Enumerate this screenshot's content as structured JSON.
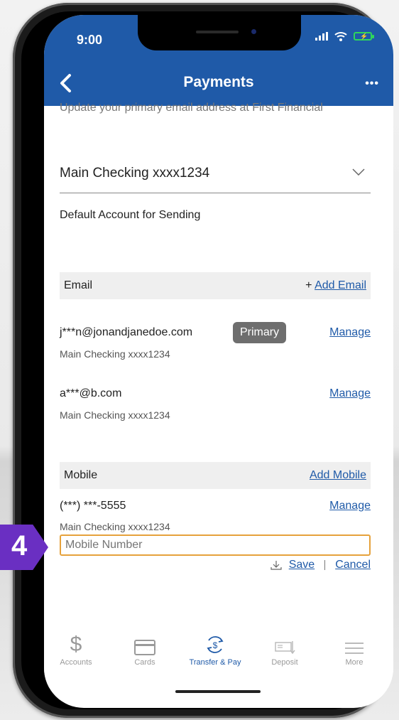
{
  "status": {
    "time": "9:00"
  },
  "header": {
    "title": "Payments"
  },
  "intro_cut_text": "Update your primary email address at First Financial",
  "account_select": {
    "value": "Main Checking xxxx1234"
  },
  "default_account_text": "Default Account for Sending",
  "email_section": {
    "label": "Email",
    "add_prefix": "+ ",
    "add_label": "Add Email",
    "items": [
      {
        "address": "j***n@jonandjanedoe.com",
        "account": "Main Checking xxxx1234",
        "badge": "Primary",
        "manage": "Manage"
      },
      {
        "address": "a***@b.com",
        "account": "Main Checking xxxx1234",
        "manage": "Manage"
      }
    ]
  },
  "mobile_section": {
    "label": "Mobile",
    "add_label": "Add Mobile",
    "items": [
      {
        "number": "(***) ***-5555",
        "account": "Main Checking xxxx1234",
        "manage": "Manage"
      }
    ],
    "input_placeholder": "Mobile Number",
    "save_label": "Save",
    "cancel_label": "Cancel"
  },
  "tabbar": {
    "tabs": [
      {
        "label": "Accounts",
        "icon": "dollar-icon"
      },
      {
        "label": "Cards",
        "icon": "card-icon"
      },
      {
        "label": "Transfer & Pay",
        "icon": "transfer-pay-icon",
        "active": true
      },
      {
        "label": "Deposit",
        "icon": "deposit-icon"
      },
      {
        "label": "More",
        "icon": "menu-icon"
      }
    ]
  },
  "step_badge": "4",
  "colors": {
    "brand": "#1f5aa8",
    "badge": "#6a2fc2",
    "focus": "#e6a23c"
  }
}
